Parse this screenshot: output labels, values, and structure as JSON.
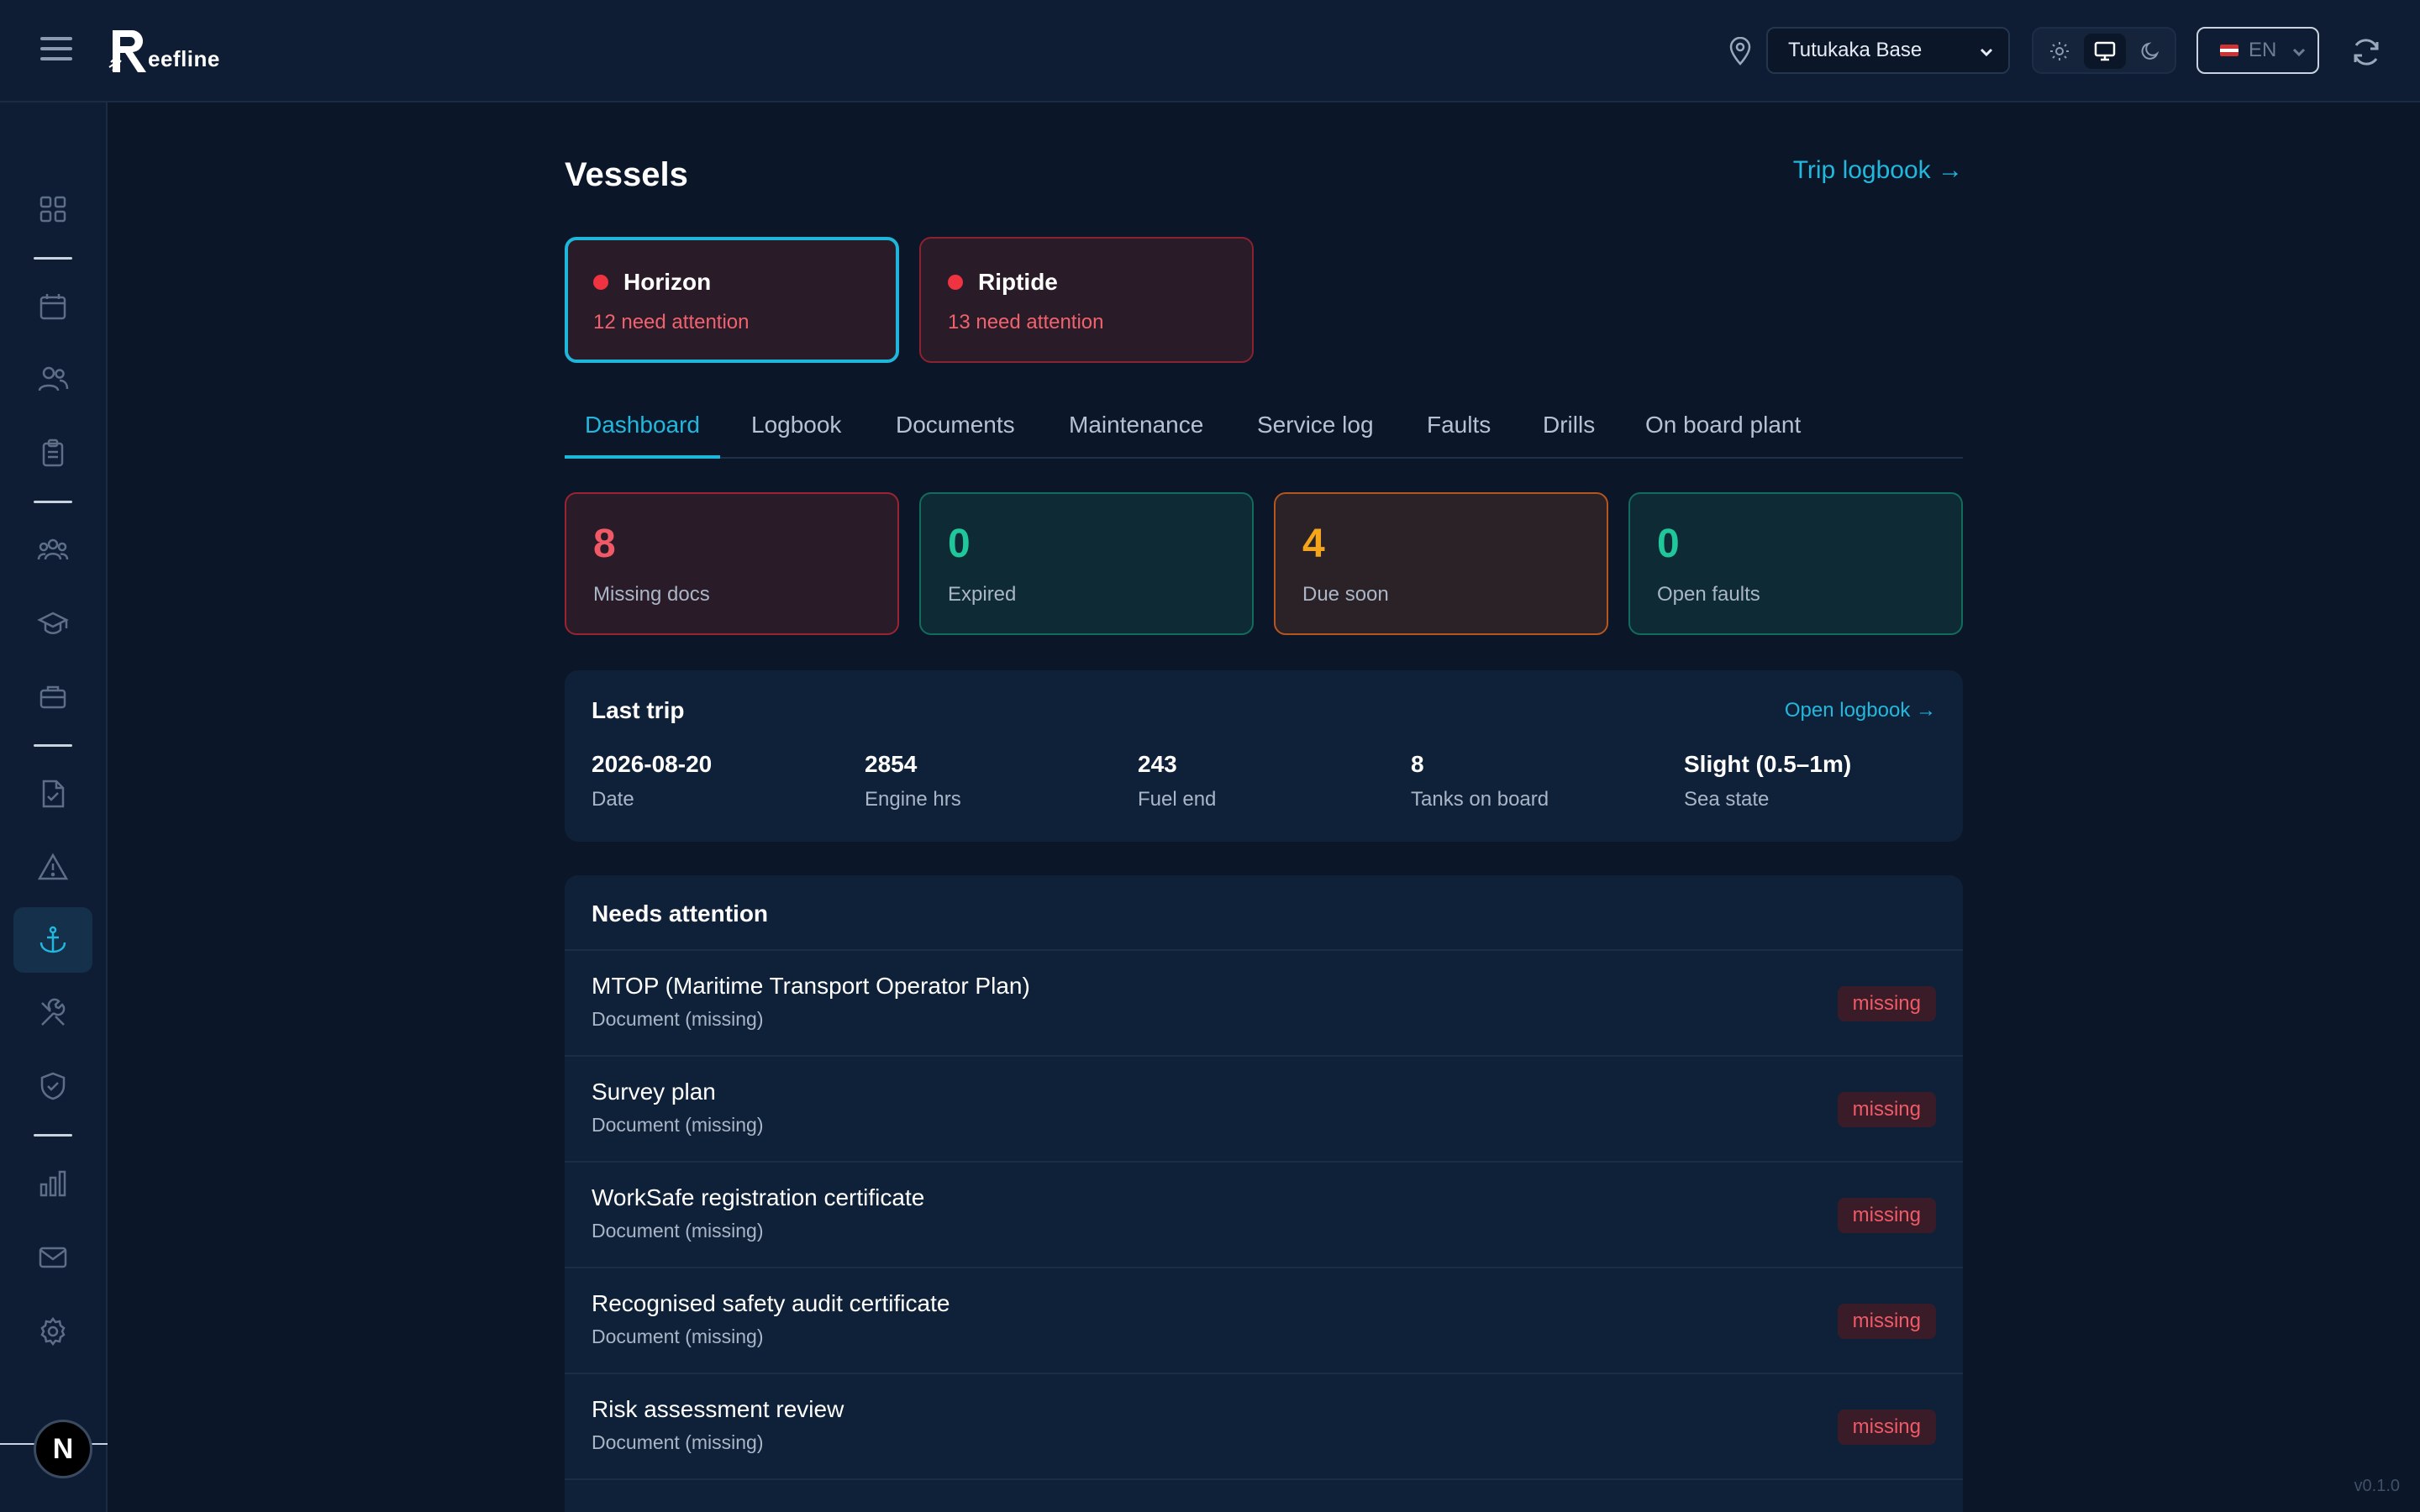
{
  "app": {
    "logo_text": "eefline"
  },
  "header": {
    "base_selected": "Tutukaka Base",
    "language": "EN"
  },
  "page": {
    "title": "Vessels",
    "trip_logbook_link": "Trip logbook →"
  },
  "vessels": [
    {
      "name": "Horizon",
      "subtitle": "12 need attention",
      "selected": true
    },
    {
      "name": "Riptide",
      "subtitle": "13 need attention",
      "selected": false
    }
  ],
  "tabs": [
    "Dashboard",
    "Logbook",
    "Documents",
    "Maintenance",
    "Service log",
    "Faults",
    "Drills",
    "On board plant"
  ],
  "active_tab": "Dashboard",
  "stats": [
    {
      "value": "8",
      "label": "Missing docs",
      "tone": "red"
    },
    {
      "value": "0",
      "label": "Expired",
      "tone": "green"
    },
    {
      "value": "4",
      "label": "Due soon",
      "tone": "orange"
    },
    {
      "value": "0",
      "label": "Open faults",
      "tone": "green"
    }
  ],
  "last_trip": {
    "title": "Last trip",
    "link": "Open logbook →",
    "fields": [
      {
        "value": "2026-08-20",
        "label": "Date"
      },
      {
        "value": "2854",
        "label": "Engine hrs"
      },
      {
        "value": "243",
        "label": "Fuel end"
      },
      {
        "value": "8",
        "label": "Tanks on board"
      },
      {
        "value": "Slight (0.5–1m)",
        "label": "Sea state"
      }
    ]
  },
  "needs_attention": {
    "title": "Needs attention",
    "items": [
      {
        "title": "MTOP (Maritime Transport Operator Plan)",
        "subtitle": "Document (missing)",
        "badge": "missing"
      },
      {
        "title": "Survey plan",
        "subtitle": "Document (missing)",
        "badge": "missing"
      },
      {
        "title": "WorkSafe registration certificate",
        "subtitle": "Document (missing)",
        "badge": "missing"
      },
      {
        "title": "Recognised safety audit certificate",
        "subtitle": "Document (missing)",
        "badge": "missing"
      },
      {
        "title": "Risk assessment review",
        "subtitle": "Document (missing)",
        "badge": "missing"
      }
    ]
  },
  "user": {
    "initial": "N"
  },
  "version": "v0.1.0",
  "colors": {
    "background": "#0b1628",
    "accent": "#22b8de",
    "danger": "#f05a66",
    "success": "#1fc79a",
    "warning": "#f4a51c"
  }
}
